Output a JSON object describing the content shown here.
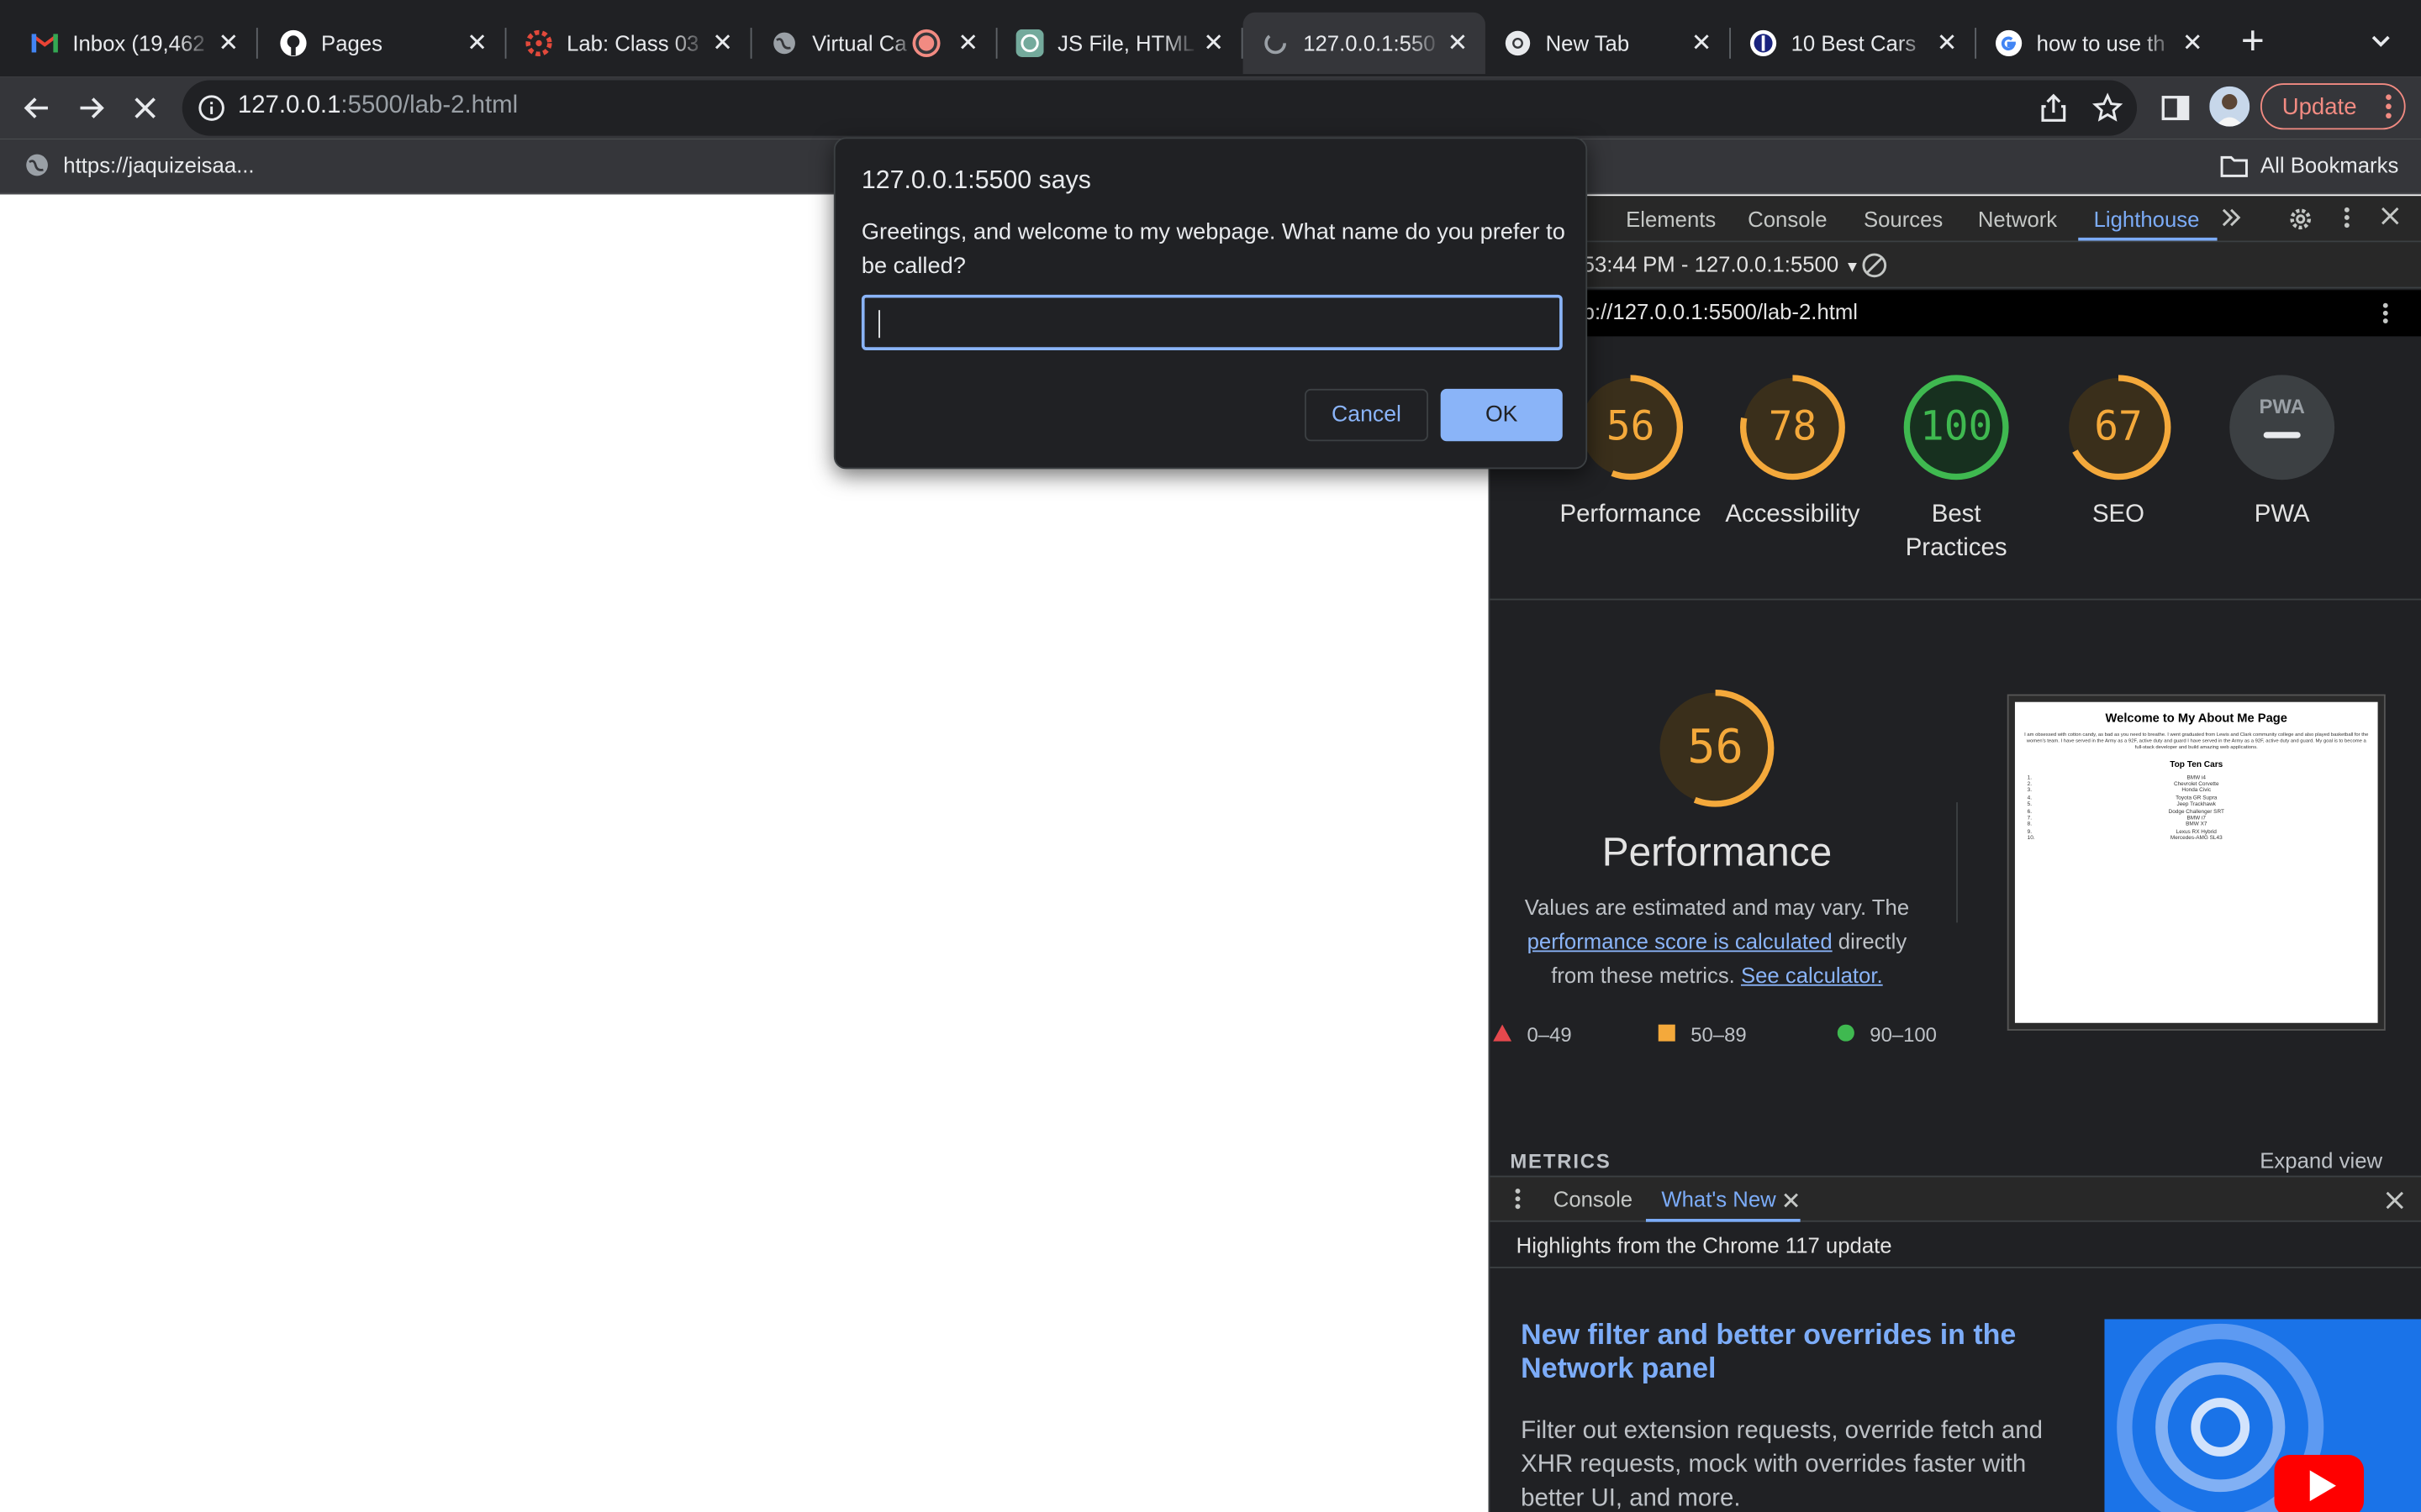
{
  "tabs": [
    {
      "title": "Inbox (19,462",
      "icon": "gmail-icon"
    },
    {
      "title": "Pages",
      "icon": "github-icon"
    },
    {
      "title": "Lab: Class 03",
      "icon": "canvas-icon"
    },
    {
      "title": "Virtual Ca",
      "icon": "globe-icon"
    },
    {
      "title": "JS File, HTML",
      "icon": "chatgpt-icon"
    },
    {
      "title": "127.0.0.1:550",
      "icon": "loading-icon",
      "active": true
    },
    {
      "title": "New Tab",
      "icon": "chrome-icon"
    },
    {
      "title": "10 Best Cars",
      "icon": "site-icon"
    },
    {
      "title": "how to use th",
      "icon": "google-icon"
    }
  ],
  "omnibox": {
    "host": "127.0.0.1",
    "rest": ":5500/lab-2.html"
  },
  "toolbar": {
    "update_label": "Update"
  },
  "bookmarks": {
    "first": "https://jaquizeisaa...",
    "all": "All Bookmarks"
  },
  "dialog": {
    "title": "127.0.0.1:5500 says",
    "message": "Greetings, and welcome to my webpage. What name do you prefer to be called?",
    "input_value": "",
    "cancel_label": "Cancel",
    "ok_label": "OK"
  },
  "devtools": {
    "tabs": [
      "Elements",
      "Console",
      "Sources",
      "Network",
      "Lighthouse"
    ],
    "active_tab": "Lighthouse",
    "report_time": "53:44 PM - 127.0.0.1:5500",
    "report_url": "p://127.0.0.1:5500/lab-2.html",
    "scores": [
      {
        "label": "Performance",
        "value": 56,
        "color": "#f4a93b"
      },
      {
        "label": "Accessibility",
        "value": 78,
        "color": "#f4a93b"
      },
      {
        "label": "Best Practices",
        "value": 100,
        "color": "#3fb950"
      },
      {
        "label": "SEO",
        "value": 67,
        "color": "#f4a93b"
      },
      {
        "label": "PWA",
        "value": null,
        "color": "#9aa0a6"
      }
    ],
    "perf_score": "56",
    "perf_title": "Performance",
    "perf_desc_1": "Values are estimated and may vary. The",
    "perf_link_1": "performance score is calculated",
    "perf_desc_2": "directly from these metrics.",
    "perf_link_2": "See calculator.",
    "legend": [
      "0–49",
      "50–89",
      "90–100"
    ],
    "metrics_label": "METRICS",
    "expand_label": "Expand view",
    "thumb": {
      "title": "Welcome to My About Me Page",
      "para": "I am obsessed with cotton candy, as bad as you need to breathe. I went graduated from Lewis and Clark community college and also played basketball for the women's team. I have served in the Army as a 92F, active duty and guard I have served in the Army as a 92F, active duty and guard. My goal is to become a full-stack developer and build amazing web applications.",
      "list_title": "Top Ten Cars",
      "cars": [
        "BMW i4",
        "Chevrolet Corvette",
        "Honda Civic",
        "Toyota GR Supra",
        "Jeep Trackhawk",
        "Dodge Challenger SRT",
        "BMW i7",
        "BMW X7",
        "Lexus RX Hybrid",
        "Mercedes-AMG SL43"
      ]
    },
    "drawer": {
      "console": "Console",
      "whats_new": "What's New"
    },
    "whatsnew_head": "Highlights from the Chrome 117 update",
    "whatsnew_title": "New filter and better overrides in the Network panel",
    "whatsnew_desc": "Filter out extension requests, override fetch and XHR requests, mock with overrides faster with better UI, and more."
  }
}
